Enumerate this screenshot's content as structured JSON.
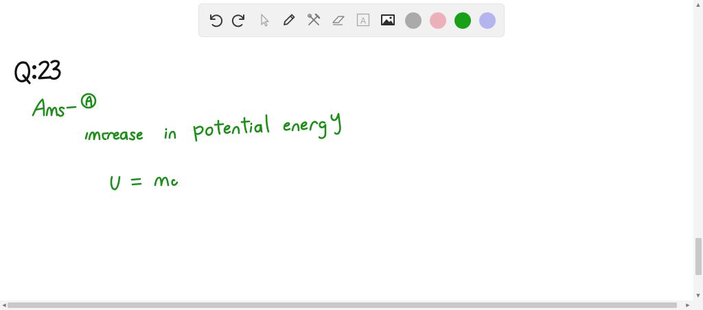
{
  "toolbar": {
    "tools": [
      {
        "icon": "undo-icon"
      },
      {
        "icon": "redo-icon"
      },
      {
        "icon": "select-pointer-icon"
      },
      {
        "icon": "pen-icon"
      },
      {
        "icon": "tools-icon"
      },
      {
        "icon": "eraser-icon"
      },
      {
        "icon": "text-box-icon",
        "glyph": "A"
      },
      {
        "icon": "image-icon"
      }
    ],
    "colors": [
      {
        "name": "gray",
        "hex": "#aaaaaa"
      },
      {
        "name": "pink",
        "hex": "#eab1b8"
      },
      {
        "name": "green",
        "hex": "#18a016",
        "selected": true
      },
      {
        "name": "lavender",
        "hex": "#b6b4ef"
      }
    ]
  },
  "ink_color": "#1b8f17",
  "handwriting": {
    "question": "Q:23",
    "answer_label": "Ans-",
    "answer_choice": "a",
    "line1": "increase in potential energy",
    "line2": "U = mg"
  }
}
